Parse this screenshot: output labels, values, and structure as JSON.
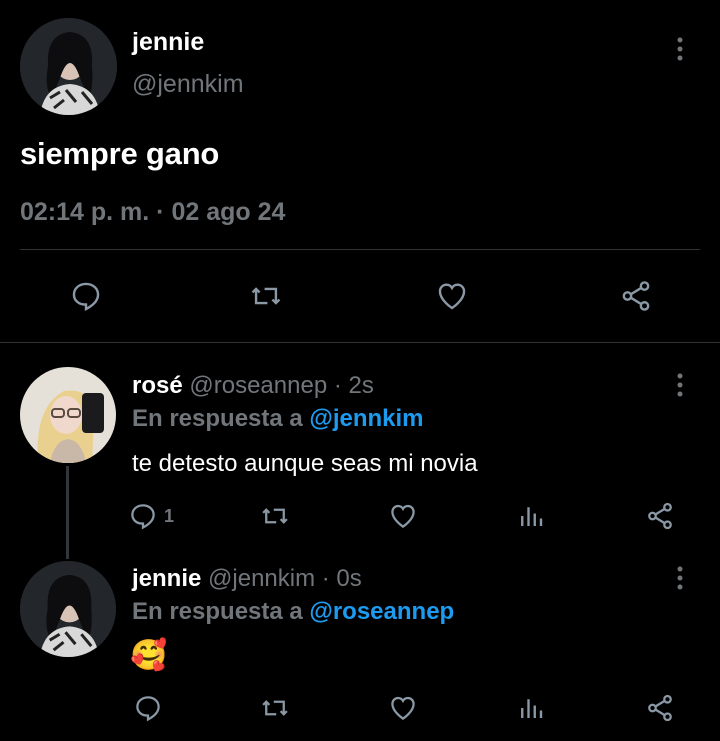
{
  "main_tweet": {
    "name": "jennie",
    "handle": "@jennkim",
    "text": "siempre gano",
    "timestamp": "02:14 p. m. · 02 ago 24",
    "actions": [
      "reply-icon",
      "retweet-icon",
      "like-icon",
      "share-icon"
    ]
  },
  "replies": [
    {
      "name": "rosé",
      "meta": "@roseannep · 2s",
      "reply_prefix": "En respuesta a ",
      "reply_mention": "@jennkim",
      "text": "te detesto aunque seas mi novia",
      "reply_count": "1",
      "actions": [
        "reply-icon",
        "retweet-icon",
        "like-icon",
        "views-icon",
        "share-icon"
      ]
    },
    {
      "name": "jennie",
      "meta": "@jennkim · 0s",
      "reply_prefix": "En respuesta a ",
      "reply_mention": "@roseannep",
      "text": "🥰",
      "actions": [
        "reply-icon",
        "retweet-icon",
        "like-icon",
        "views-icon",
        "share-icon"
      ]
    }
  ],
  "colors": {
    "background": "#000000",
    "secondary_text": "#71767b",
    "mention": "#1d9bf0",
    "divider": "#2f3336"
  }
}
